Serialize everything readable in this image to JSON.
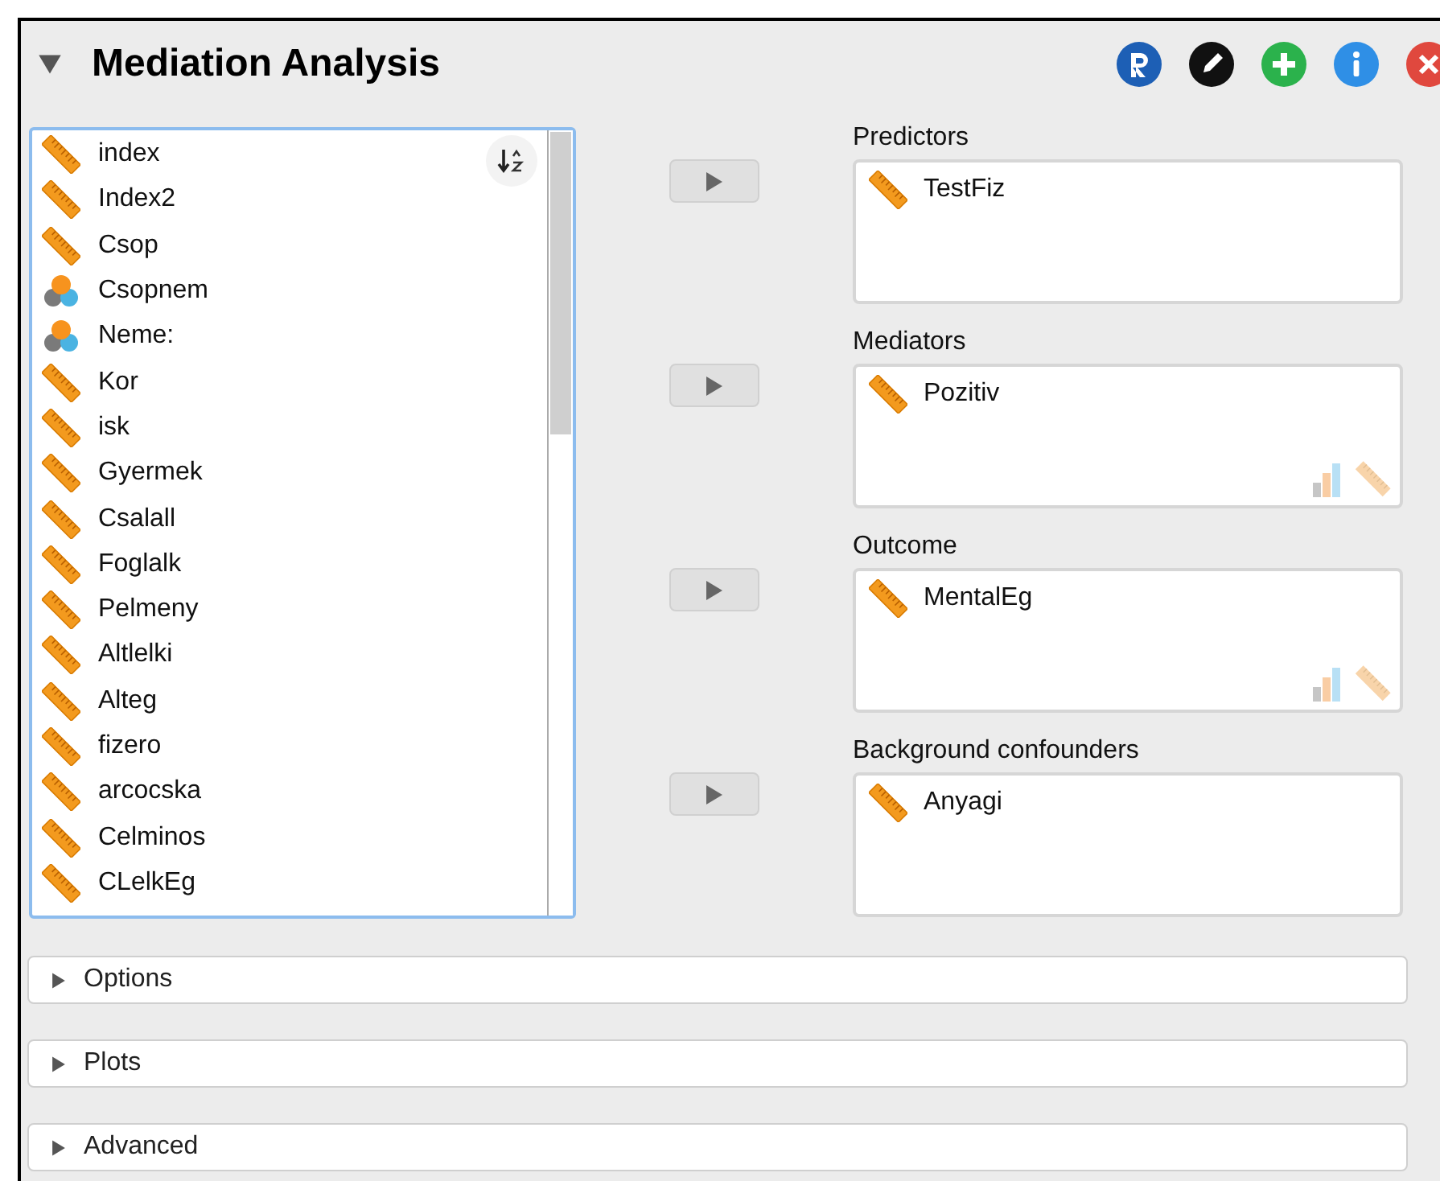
{
  "panel": {
    "title": "Mediation Analysis",
    "expanded": true
  },
  "variables": [
    {
      "name": "index",
      "kind": "continuous"
    },
    {
      "name": "Index2",
      "kind": "continuous"
    },
    {
      "name": "Csop",
      "kind": "continuous"
    },
    {
      "name": "Csopnem",
      "kind": "nominal"
    },
    {
      "name": "Neme:",
      "kind": "nominal"
    },
    {
      "name": "Kor",
      "kind": "continuous"
    },
    {
      "name": "isk",
      "kind": "continuous"
    },
    {
      "name": "Gyermek",
      "kind": "continuous"
    },
    {
      "name": "Csalall",
      "kind": "continuous"
    },
    {
      "name": "Foglalk",
      "kind": "continuous"
    },
    {
      "name": "Pelmeny",
      "kind": "continuous"
    },
    {
      "name": "Altlelki",
      "kind": "continuous"
    },
    {
      "name": "Alteg",
      "kind": "continuous"
    },
    {
      "name": "fizero",
      "kind": "continuous"
    },
    {
      "name": "arcocska",
      "kind": "continuous"
    },
    {
      "name": "Celminos",
      "kind": "continuous"
    },
    {
      "name": "CLelkEg",
      "kind": "continuous"
    }
  ],
  "targets": [
    {
      "label": "Predictors",
      "type_hint": false,
      "items": [
        {
          "name": "TestFiz",
          "kind": "continuous"
        }
      ]
    },
    {
      "label": "Mediators",
      "type_hint": true,
      "items": [
        {
          "name": "Pozitiv",
          "kind": "continuous"
        }
      ]
    },
    {
      "label": "Outcome",
      "type_hint": true,
      "items": [
        {
          "name": "MentalEg",
          "kind": "continuous"
        }
      ]
    },
    {
      "label": "Background confounders",
      "type_hint": false,
      "items": [
        {
          "name": "Anyagi",
          "kind": "continuous"
        }
      ]
    }
  ],
  "sections": [
    {
      "label": "Options",
      "expanded": false
    },
    {
      "label": "Plots",
      "expanded": false
    },
    {
      "label": "Advanced",
      "expanded": false
    }
  ]
}
